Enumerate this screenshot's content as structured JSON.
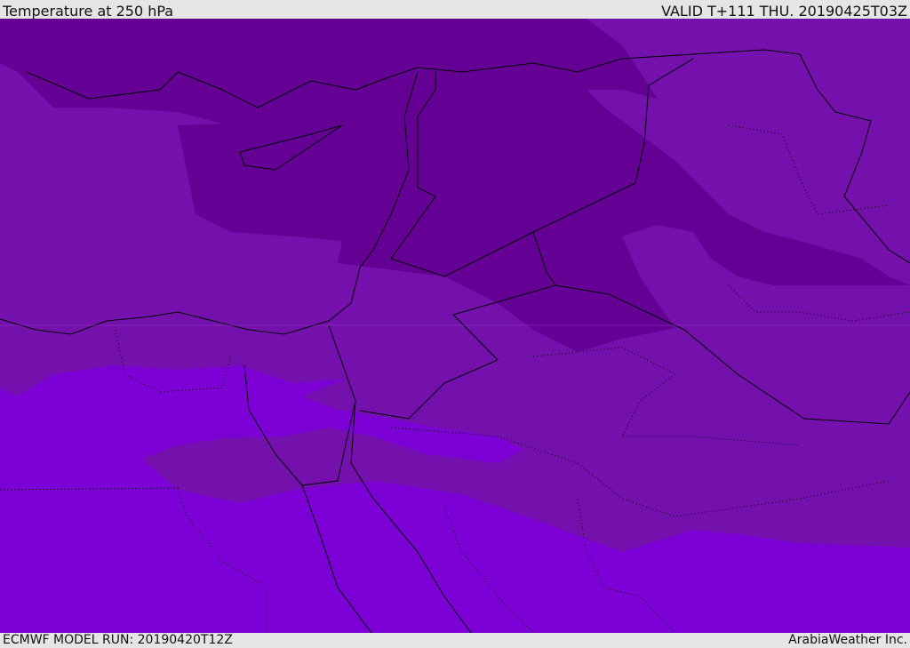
{
  "header": {
    "title": "Temperature at 250 hPa",
    "valid": "VALID T+111 THU. 20190425T03Z"
  },
  "footer": {
    "model_run": "ECMWF MODEL RUN: 20190420T12Z",
    "credit": "ArabiaWeather Inc."
  },
  "colors": {
    "cold": "#650095",
    "mid": "#7411ad",
    "warm": "#7c00d6",
    "border": "#000000"
  }
}
